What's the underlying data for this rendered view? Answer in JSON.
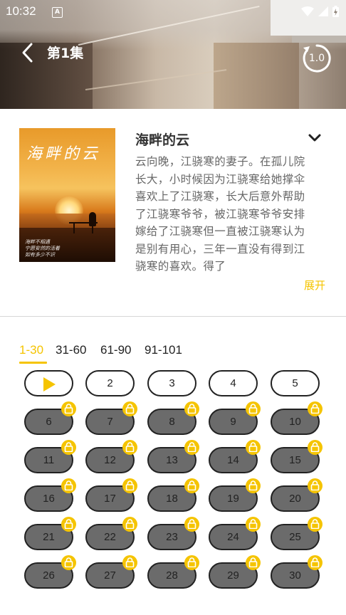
{
  "status_bar": {
    "time": "10:32",
    "notification": "A"
  },
  "header": {
    "back_icon": "chevron-left-icon",
    "episode_title": "第1集",
    "speed": "1.0"
  },
  "show": {
    "title": "海畔的云",
    "cover_title": "海畔的云",
    "cover_poem": [
      "海畔不相遇",
      "宁愿安然的活着",
      "如有多少不识"
    ],
    "description": "云向晚，江骁寒的妻子。在孤儿院长大，小时候因为江骁寒给她撑伞喜欢上了江骁寒，长大后意外帮助了江骁寒爷爷，被江骁寒爷爷安排嫁给了江骁寒但一直被江骁寒认为是别有用心，三年一直没有得到江骁寒的喜欢。得了",
    "expand_label": "展开"
  },
  "tabs": [
    {
      "label": "1-30",
      "active": true
    },
    {
      "label": "31-60",
      "active": false
    },
    {
      "label": "61-90",
      "active": false
    },
    {
      "label": "91-101",
      "active": false
    }
  ],
  "episodes": [
    {
      "label": "",
      "playing": true,
      "locked": false
    },
    {
      "label": "2",
      "locked": false
    },
    {
      "label": "3",
      "locked": false
    },
    {
      "label": "4",
      "locked": false
    },
    {
      "label": "5",
      "locked": false
    },
    {
      "label": "6",
      "locked": true
    },
    {
      "label": "7",
      "locked": true
    },
    {
      "label": "8",
      "locked": true
    },
    {
      "label": "9",
      "locked": true
    },
    {
      "label": "10",
      "locked": true
    },
    {
      "label": "11",
      "locked": true
    },
    {
      "label": "12",
      "locked": true
    },
    {
      "label": "13",
      "locked": true
    },
    {
      "label": "14",
      "locked": true
    },
    {
      "label": "15",
      "locked": true
    },
    {
      "label": "16",
      "locked": true
    },
    {
      "label": "17",
      "locked": true
    },
    {
      "label": "18",
      "locked": true
    },
    {
      "label": "19",
      "locked": true
    },
    {
      "label": "20",
      "locked": true
    },
    {
      "label": "21",
      "locked": true
    },
    {
      "label": "22",
      "locked": true
    },
    {
      "label": "23",
      "locked": true
    },
    {
      "label": "24",
      "locked": true
    },
    {
      "label": "25",
      "locked": true
    },
    {
      "label": "26",
      "locked": true
    },
    {
      "label": "27",
      "locked": true
    },
    {
      "label": "28",
      "locked": true
    },
    {
      "label": "29",
      "locked": true
    },
    {
      "label": "30",
      "locked": true
    }
  ],
  "colors": {
    "accent": "#f5c400",
    "locked_fill": "#6b6b6b"
  }
}
